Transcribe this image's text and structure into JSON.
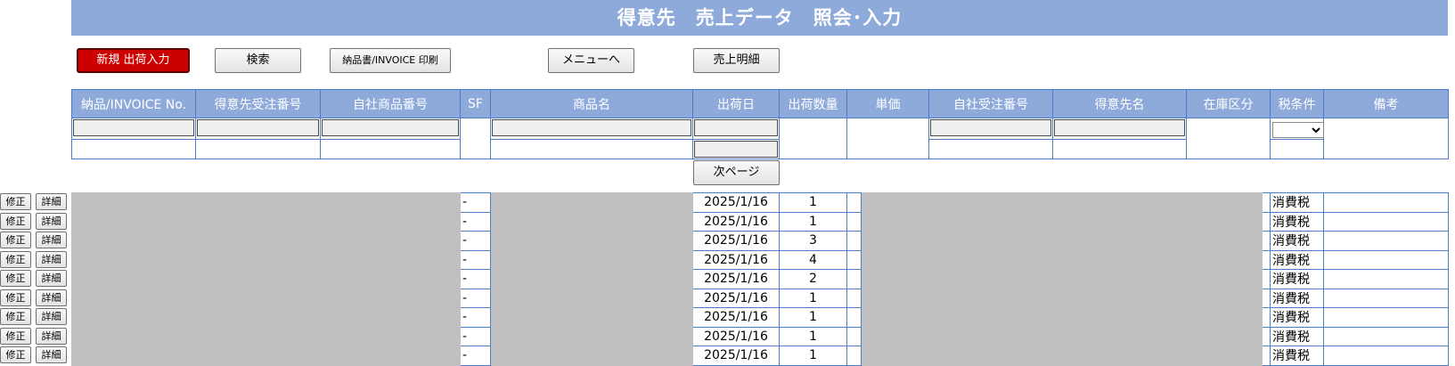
{
  "header": {
    "title": "得意先　売上データ　照会･入力"
  },
  "toolbar": {
    "new_shipment": "新規 出荷入力",
    "search": "検索",
    "print": "納品書/INVOICE 印刷",
    "menu": "メニューへ",
    "sales_detail": "売上明細"
  },
  "search_table": {
    "columns": [
      "納品/INVOICE No.",
      "得意先受注番号",
      "自社商品番号",
      "SF",
      "商品名",
      "出荷日",
      "出荷数量",
      "単価",
      "自社受注番号",
      "得意先名",
      "在庫区分",
      "税条件",
      "備考"
    ]
  },
  "pagination": {
    "next_label": "次ページ"
  },
  "row_actions": {
    "edit": "修正",
    "detail": "詳細"
  },
  "rows": [
    {
      "sf": "-",
      "date": "2025/1/16",
      "qty": "1",
      "tax": "消費税"
    },
    {
      "sf": "-",
      "date": "2025/1/16",
      "qty": "1",
      "tax": "消費税"
    },
    {
      "sf": "-",
      "date": "2025/1/16",
      "qty": "3",
      "tax": "消費税"
    },
    {
      "sf": "-",
      "date": "2025/1/16",
      "qty": "4",
      "tax": "消費税"
    },
    {
      "sf": "-",
      "date": "2025/1/16",
      "qty": "2",
      "tax": "消費税"
    },
    {
      "sf": "-",
      "date": "2025/1/16",
      "qty": "1",
      "tax": "消費税"
    },
    {
      "sf": "-",
      "date": "2025/1/16",
      "qty": "1",
      "tax": "消費税"
    },
    {
      "sf": "-",
      "date": "2025/1/16",
      "qty": "1",
      "tax": "消費税"
    },
    {
      "sf": "-",
      "date": "2025/1/16",
      "qty": "1",
      "tax": "消費税"
    }
  ],
  "colors": {
    "header_bg": "#8eaadb",
    "border": "#4a7cc9",
    "primary_button": "#cc0000",
    "redacted": "#c0c0c0"
  }
}
